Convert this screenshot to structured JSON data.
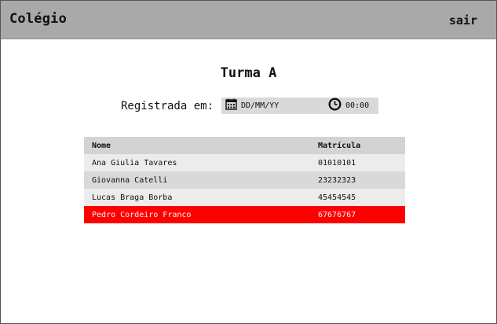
{
  "header": {
    "brand": "Colégio",
    "logout_label": "sair"
  },
  "main": {
    "title": "Turma A",
    "registered_label": "Registrada em:",
    "date_value": "DD/MM/YY",
    "date_icon": "calendar-icon",
    "time_value": "00:00",
    "time_icon": "clock-icon"
  },
  "table": {
    "columns": [
      "Nome",
      "Matrícula"
    ],
    "rows": [
      {
        "name": "Ana Giulia Tavares",
        "id": "01010101"
      },
      {
        "name": "Giovanna Catelli",
        "id": "23232323"
      },
      {
        "name": "Lucas Braga Borba",
        "id": "45454545"
      },
      {
        "name": "Pedro Cordeiro Franco",
        "id": "67676767",
        "selected": true
      }
    ]
  },
  "colors": {
    "topbar": "#a9a9a9",
    "selected_row": "#ff0000",
    "header_row": "#d3d3d3"
  }
}
